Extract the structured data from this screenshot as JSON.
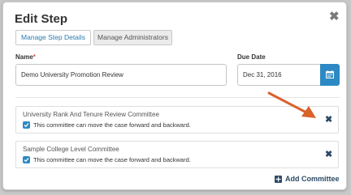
{
  "modal": {
    "title": "Edit Step",
    "close_glyph": "✖"
  },
  "tabs": [
    {
      "label": "Manage Step Details",
      "active": true
    },
    {
      "label": "Manage Administrators",
      "active": false
    }
  ],
  "form": {
    "name_label": "Name",
    "required_mark": "*",
    "name_value": "Demo University Promotion Review",
    "due_date_label": "Due Date",
    "due_date_value": "Dec 31, 2016",
    "calendar_icon": "calendar-icon"
  },
  "committees": [
    {
      "name": "University Rank And Tenure Review Committee",
      "checkbox_label": "This committee can move the case forward and backward.",
      "checked": true,
      "remove_glyph": "✖"
    },
    {
      "name": "Sample College Level Committee",
      "checkbox_label": "This committee can move the case forward and backward.",
      "checked": true,
      "remove_glyph": "✖"
    }
  ],
  "add_committee": {
    "label": "Add Committee",
    "icon": "plus-square-icon"
  },
  "colors": {
    "accent": "#2d89c3",
    "dark_icon": "#2c4a66",
    "annotation_arrow": "#d9622b",
    "required": "#d9534f"
  }
}
